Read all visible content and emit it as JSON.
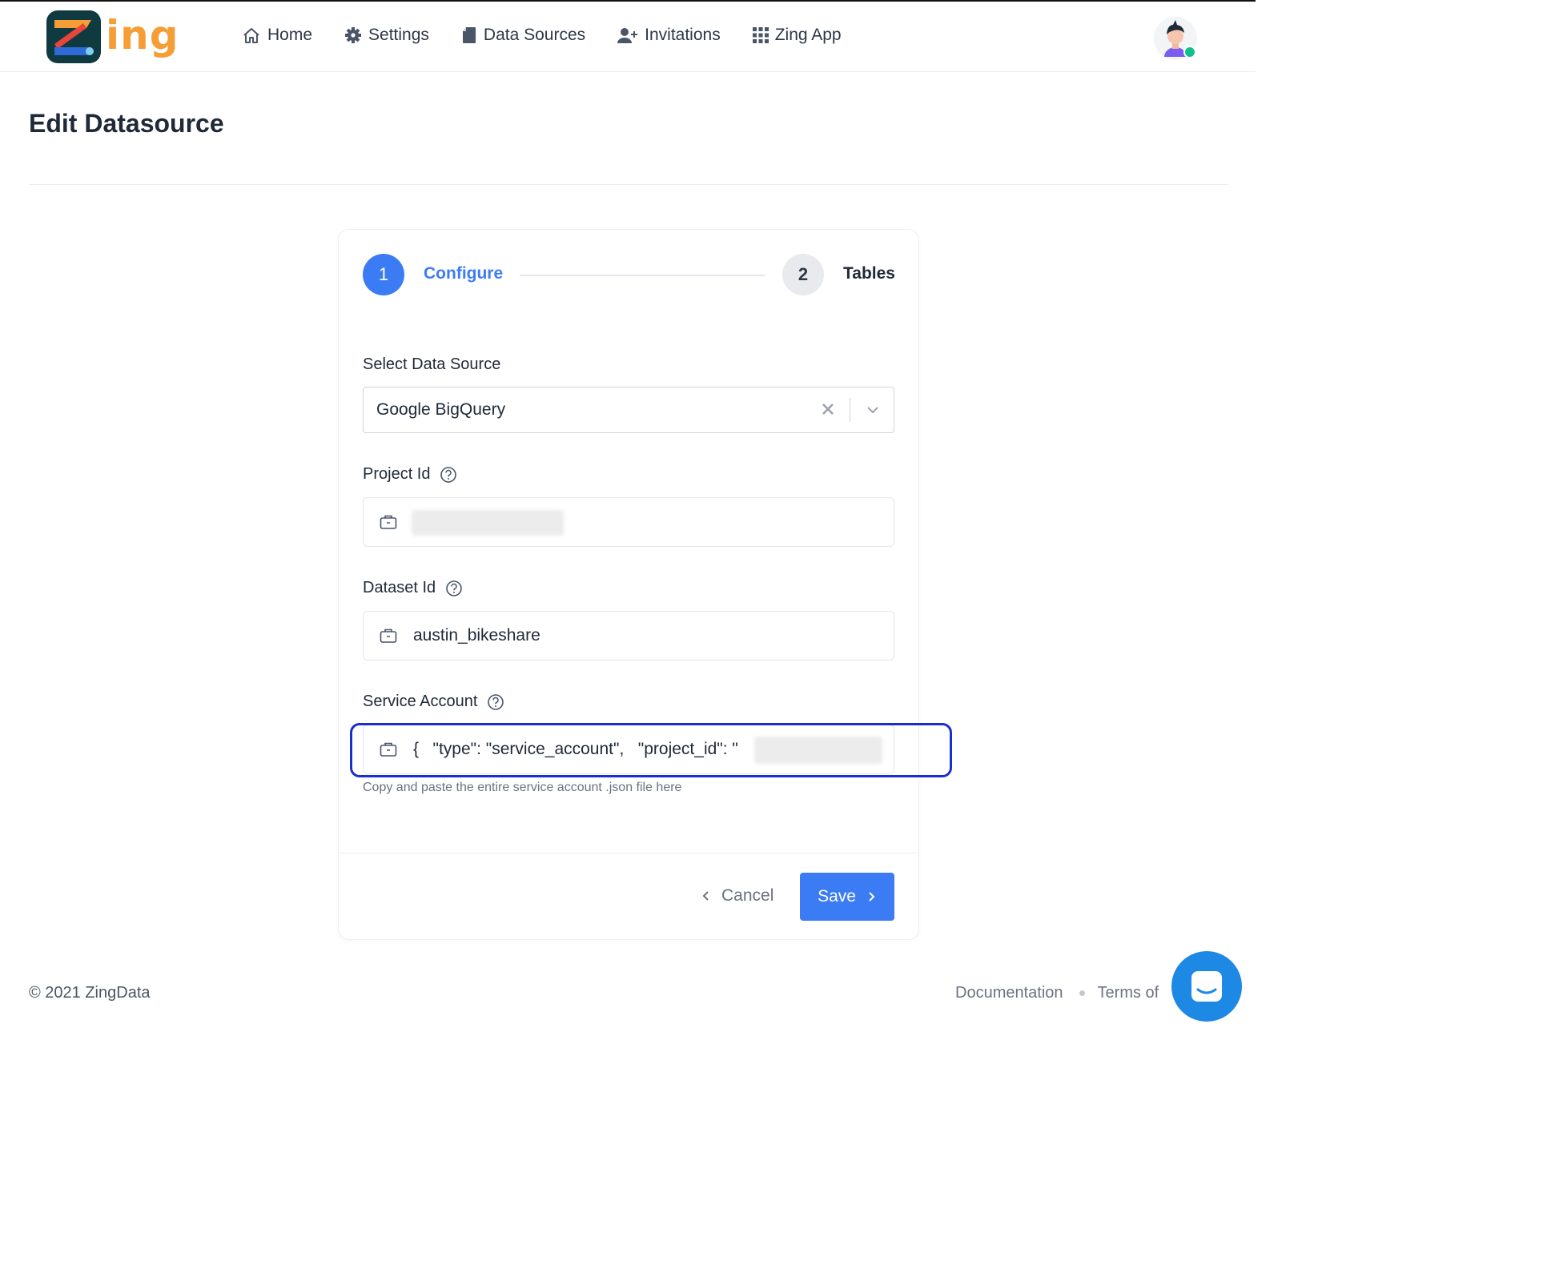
{
  "brand": {
    "logo_text": "ing",
    "accent_color": "#f59e36",
    "primary_color": "#3b7cf5"
  },
  "nav": {
    "items": [
      {
        "label": "Home",
        "icon": "home-icon"
      },
      {
        "label": "Settings",
        "icon": "gear-icon"
      },
      {
        "label": "Data Sources",
        "icon": "document-icon"
      },
      {
        "label": "Invitations",
        "icon": "user-plus-icon"
      },
      {
        "label": "Zing App",
        "icon": "grid-icon"
      }
    ]
  },
  "page": {
    "title": "Edit Datasource"
  },
  "stepper": {
    "steps": [
      {
        "number": "1",
        "label": "Configure",
        "active": true
      },
      {
        "number": "2",
        "label": "Tables",
        "active": false
      }
    ]
  },
  "form": {
    "data_source": {
      "label": "Select Data Source",
      "value": "Google BigQuery"
    },
    "project_id": {
      "label": "Project Id",
      "value": ""
    },
    "dataset_id": {
      "label": "Dataset Id",
      "value": "austin_bikeshare"
    },
    "service_account": {
      "label": "Service Account",
      "value": "{   \"type\": \"service_account\",   \"project_id\": \"",
      "hint": "Copy and paste the entire service account .json file here"
    }
  },
  "actions": {
    "cancel_label": "Cancel",
    "save_label": "Save"
  },
  "footer": {
    "copyright": "© 2021 ZingData",
    "links": [
      "Documentation",
      "Terms of"
    ]
  }
}
